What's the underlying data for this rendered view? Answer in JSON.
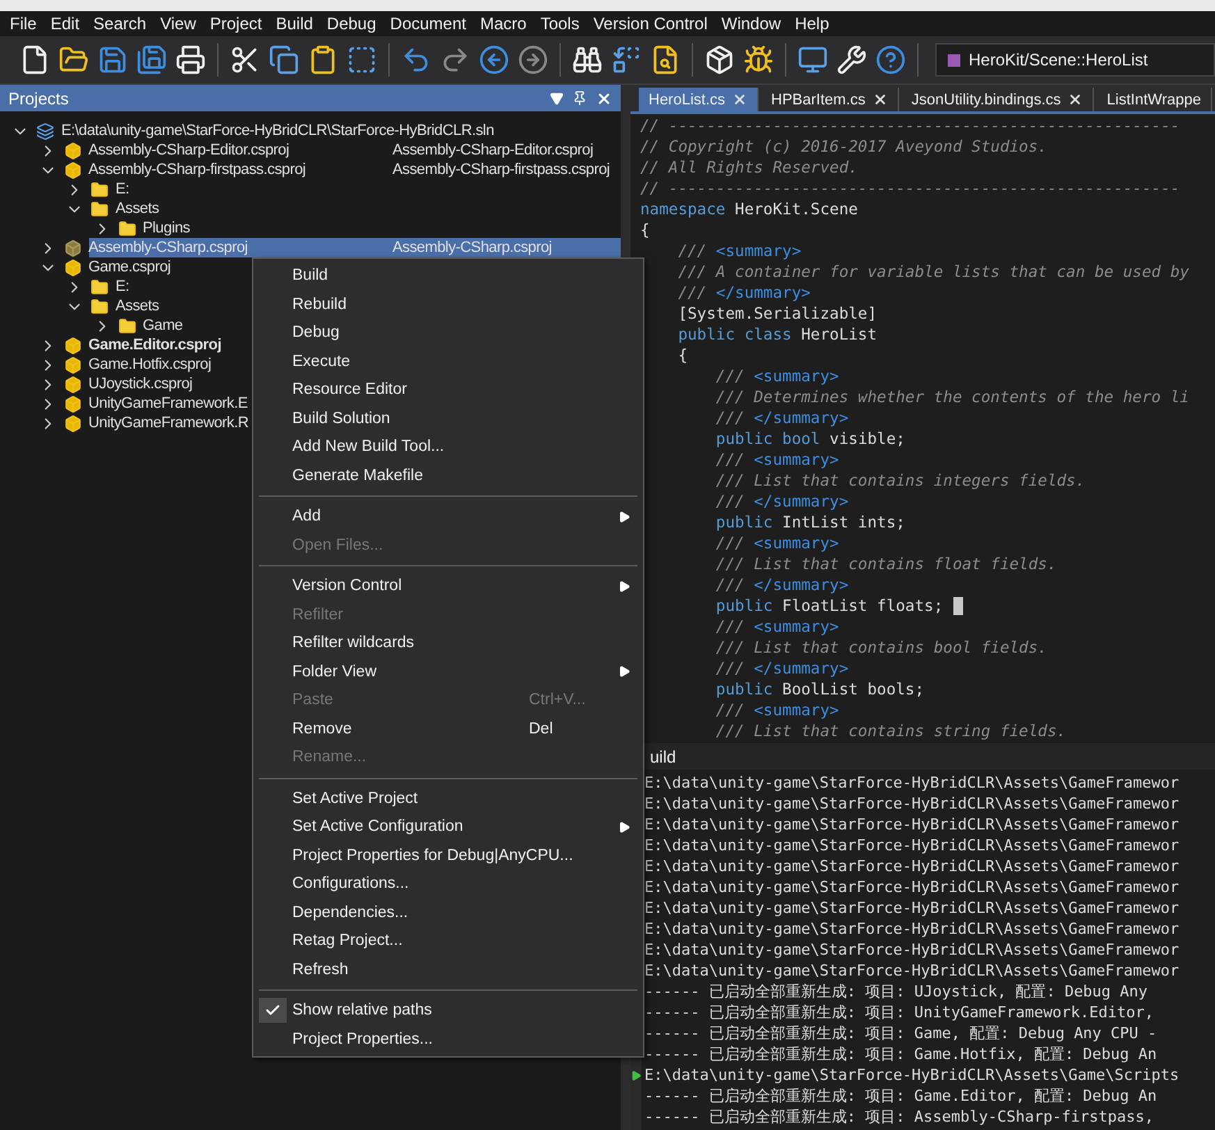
{
  "menu_bar": [
    "File",
    "Edit",
    "Search",
    "View",
    "Project",
    "Build",
    "Debug",
    "Document",
    "Macro",
    "Tools",
    "Version Control",
    "Window",
    "Help"
  ],
  "toolbar": {
    "symbol_dropdown": "HeroKit/Scene::HeroList"
  },
  "projects_panel": {
    "title": "Projects",
    "tree": [
      {
        "kind": "solution",
        "label": "E:\\data\\unity-game\\StarForce-HyBridCLR\\StarForce-HyBridCLR.sln",
        "expanded": true,
        "selected": false,
        "bold": false,
        "children": [
          {
            "kind": "project",
            "label": "Assembly-CSharp-Editor.csproj",
            "detail": "Assembly-CSharp-Editor.csproj",
            "expanded": false,
            "selected": false,
            "bold": false
          },
          {
            "kind": "project",
            "label": "Assembly-CSharp-firstpass.csproj",
            "detail": "Assembly-CSharp-firstpass.csproj",
            "expanded": true,
            "selected": false,
            "bold": false,
            "children": [
              {
                "kind": "folder",
                "label": "E:",
                "expanded": false,
                "selected": false,
                "bold": false
              },
              {
                "kind": "folder",
                "label": "Assets",
                "expanded": true,
                "selected": false,
                "bold": false,
                "children": [
                  {
                    "kind": "folder",
                    "label": "Plugins",
                    "expanded": false,
                    "selected": false,
                    "bold": false
                  }
                ]
              }
            ]
          },
          {
            "kind": "project",
            "label": "Assembly-CSharp.csproj",
            "detail": "Assembly-CSharp.csproj",
            "expanded": false,
            "selected": true,
            "bold": false
          },
          {
            "kind": "project",
            "label": "Game.csproj",
            "expanded": true,
            "selected": false,
            "bold": false,
            "children": [
              {
                "kind": "folder",
                "label": "E:",
                "expanded": false,
                "selected": false,
                "bold": false
              },
              {
                "kind": "folder",
                "label": "Assets",
                "expanded": true,
                "selected": false,
                "bold": false,
                "children": [
                  {
                    "kind": "folder",
                    "label": "Game",
                    "expanded": false,
                    "selected": false,
                    "bold": false
                  }
                ]
              }
            ]
          },
          {
            "kind": "project",
            "label": "Game.Editor.csproj",
            "expanded": false,
            "selected": false,
            "bold": true
          },
          {
            "kind": "project",
            "label": "Game.Hotfix.csproj",
            "expanded": false,
            "selected": false,
            "bold": false
          },
          {
            "kind": "project",
            "label": "UJoystick.csproj",
            "expanded": false,
            "selected": false,
            "bold": false
          },
          {
            "kind": "project",
            "label": "UnityGameFramework.E",
            "expanded": false,
            "selected": false,
            "bold": false
          },
          {
            "kind": "project",
            "label": "UnityGameFramework.R",
            "expanded": false,
            "selected": false,
            "bold": false
          }
        ]
      }
    ]
  },
  "editor": {
    "tabs": [
      {
        "label": "HeroList.cs",
        "selected": true
      },
      {
        "label": "HPBarItem.cs",
        "selected": false
      },
      {
        "label": "JsonUtility.bindings.cs",
        "selected": false
      },
      {
        "label": "ListIntWrappe",
        "selected": false
      }
    ],
    "lines": [
      {
        "cursor": false,
        "segments": [
          {
            "kind": "comment",
            "t": "// ------------------------------------------------------"
          }
        ]
      },
      {
        "cursor": false,
        "segments": [
          {
            "kind": "comment",
            "t": "// Copyright (c) 2016-2017 Aveyond Studios."
          }
        ]
      },
      {
        "cursor": false,
        "segments": [
          {
            "kind": "comment",
            "t": "// All Rights Reserved."
          }
        ]
      },
      {
        "cursor": false,
        "segments": [
          {
            "kind": "comment",
            "t": "// ------------------------------------------------------"
          }
        ]
      },
      {
        "cursor": false,
        "segments": [
          {
            "kind": "keyword",
            "t": "namespace"
          },
          {
            "kind": "plain",
            "t": " HeroKit.Scene"
          }
        ]
      },
      {
        "cursor": false,
        "segments": [
          {
            "kind": "plain",
            "t": "{"
          }
        ]
      },
      {
        "cursor": false,
        "segments": [
          {
            "kind": "comment",
            "t": "    /// "
          },
          {
            "kind": "tag",
            "t": "<summary>"
          }
        ]
      },
      {
        "cursor": false,
        "segments": [
          {
            "kind": "comment",
            "t": "    /// A container for variable lists that can be used by"
          }
        ]
      },
      {
        "cursor": false,
        "segments": [
          {
            "kind": "comment",
            "t": "    /// "
          },
          {
            "kind": "tag",
            "t": "</summary>"
          }
        ]
      },
      {
        "cursor": false,
        "segments": [
          {
            "kind": "plain",
            "t": "    [System.Serializable]"
          }
        ]
      },
      {
        "cursor": false,
        "segments": [
          {
            "kind": "keyword",
            "t": "    public class"
          },
          {
            "kind": "plain",
            "t": " HeroList"
          }
        ]
      },
      {
        "cursor": false,
        "segments": [
          {
            "kind": "plain",
            "t": "    {"
          }
        ]
      },
      {
        "cursor": false,
        "segments": [
          {
            "kind": "comment",
            "t": "        /// "
          },
          {
            "kind": "tag",
            "t": "<summary>"
          }
        ]
      },
      {
        "cursor": false,
        "segments": [
          {
            "kind": "comment",
            "t": "        /// Determines whether the contents of the hero li"
          }
        ]
      },
      {
        "cursor": false,
        "segments": [
          {
            "kind": "comment",
            "t": "        /// "
          },
          {
            "kind": "tag",
            "t": "</summary>"
          }
        ]
      },
      {
        "cursor": false,
        "segments": [
          {
            "kind": "keyword",
            "t": "        public bool"
          },
          {
            "kind": "plain",
            "t": " visible;"
          }
        ]
      },
      {
        "cursor": false,
        "segments": [
          {
            "kind": "comment",
            "t": "        /// "
          },
          {
            "kind": "tag",
            "t": "<summary>"
          }
        ]
      },
      {
        "cursor": false,
        "segments": [
          {
            "kind": "comment",
            "t": "        /// List that contains integers fields."
          }
        ]
      },
      {
        "cursor": false,
        "segments": [
          {
            "kind": "comment",
            "t": "        /// "
          },
          {
            "kind": "tag",
            "t": "</summary>"
          }
        ]
      },
      {
        "cursor": false,
        "segments": [
          {
            "kind": "keyword",
            "t": "        public"
          },
          {
            "kind": "plain",
            "t": " IntList ints;"
          }
        ]
      },
      {
        "cursor": false,
        "segments": [
          {
            "kind": "comment",
            "t": "        /// "
          },
          {
            "kind": "tag",
            "t": "<summary>"
          }
        ]
      },
      {
        "cursor": false,
        "segments": [
          {
            "kind": "comment",
            "t": "        /// List that contains float fields."
          }
        ]
      },
      {
        "cursor": false,
        "segments": [
          {
            "kind": "comment",
            "t": "        /// "
          },
          {
            "kind": "tag",
            "t": "</summary>"
          }
        ]
      },
      {
        "cursor": true,
        "segments": [
          {
            "kind": "keyword",
            "t": "        public"
          },
          {
            "kind": "plain",
            "t": " FloatList floats;"
          }
        ]
      },
      {
        "cursor": false,
        "segments": [
          {
            "kind": "comment",
            "t": "        /// "
          },
          {
            "kind": "tag",
            "t": "<summary>"
          }
        ]
      },
      {
        "cursor": false,
        "segments": [
          {
            "kind": "comment",
            "t": "        /// List that contains bool fields."
          }
        ]
      },
      {
        "cursor": false,
        "segments": [
          {
            "kind": "comment",
            "t": "        /// "
          },
          {
            "kind": "tag",
            "t": "</summary>"
          }
        ]
      },
      {
        "cursor": false,
        "segments": [
          {
            "kind": "keyword",
            "t": "        public"
          },
          {
            "kind": "plain",
            "t": " BoolList bools;"
          }
        ]
      },
      {
        "cursor": false,
        "segments": [
          {
            "kind": "comment",
            "t": "        /// "
          },
          {
            "kind": "tag",
            "t": "<summary>"
          }
        ]
      },
      {
        "cursor": false,
        "segments": [
          {
            "kind": "comment",
            "t": "        /// List that contains string fields."
          }
        ]
      }
    ]
  },
  "build_panel": {
    "title": "uild",
    "lines": [
      {
        "marker": false,
        "text": "E:\\data\\unity-game\\StarForce-HyBridCLR\\Assets\\GameFramewor"
      },
      {
        "marker": false,
        "text": "E:\\data\\unity-game\\StarForce-HyBridCLR\\Assets\\GameFramewor"
      },
      {
        "marker": false,
        "text": "E:\\data\\unity-game\\StarForce-HyBridCLR\\Assets\\GameFramewor"
      },
      {
        "marker": false,
        "text": "E:\\data\\unity-game\\StarForce-HyBridCLR\\Assets\\GameFramewor"
      },
      {
        "marker": false,
        "text": "E:\\data\\unity-game\\StarForce-HyBridCLR\\Assets\\GameFramewor"
      },
      {
        "marker": false,
        "text": "E:\\data\\unity-game\\StarForce-HyBridCLR\\Assets\\GameFramewor"
      },
      {
        "marker": false,
        "text": "E:\\data\\unity-game\\StarForce-HyBridCLR\\Assets\\GameFramewor"
      },
      {
        "marker": false,
        "text": "E:\\data\\unity-game\\StarForce-HyBridCLR\\Assets\\GameFramewor"
      },
      {
        "marker": false,
        "text": "E:\\data\\unity-game\\StarForce-HyBridCLR\\Assets\\GameFramewor"
      },
      {
        "marker": false,
        "text": "E:\\data\\unity-game\\StarForce-HyBridCLR\\Assets\\GameFramewor"
      },
      {
        "marker": false,
        "text": "------ 已启动全部重新生成: 项目: UJoystick, 配置: Debug Any"
      },
      {
        "marker": false,
        "text": "------ 已启动全部重新生成: 项目: UnityGameFramework.Editor,"
      },
      {
        "marker": false,
        "text": "------ 已启动全部重新生成: 项目: Game, 配置: Debug Any CPU -"
      },
      {
        "marker": false,
        "text": "------ 已启动全部重新生成: 项目: Game.Hotfix, 配置: Debug An"
      },
      {
        "marker": true,
        "text": "E:\\data\\unity-game\\StarForce-HyBridCLR\\Assets\\Game\\Scripts"
      },
      {
        "marker": false,
        "text": "------ 已启动全部重新生成: 项目: Game.Editor, 配置: Debug An"
      },
      {
        "marker": false,
        "text": "------ 已启动全部重新生成: 项目: Assembly-CSharp-firstpass,"
      }
    ]
  },
  "context_menu": [
    {
      "kind": "item",
      "label": "Build",
      "disabled": false,
      "submenu": false,
      "checked": false
    },
    {
      "kind": "item",
      "label": "Rebuild",
      "disabled": false,
      "submenu": false,
      "checked": false
    },
    {
      "kind": "item",
      "label": "Debug",
      "disabled": false,
      "submenu": false,
      "checked": false
    },
    {
      "kind": "item",
      "label": "Execute",
      "disabled": false,
      "submenu": false,
      "checked": false
    },
    {
      "kind": "item",
      "label": "Resource Editor",
      "disabled": false,
      "submenu": false,
      "checked": false
    },
    {
      "kind": "item",
      "label": "Build Solution",
      "disabled": false,
      "submenu": false,
      "checked": false
    },
    {
      "kind": "item",
      "label": "Add New Build Tool...",
      "disabled": false,
      "submenu": false,
      "checked": false
    },
    {
      "kind": "item",
      "label": "Generate Makefile",
      "disabled": false,
      "submenu": false,
      "checked": false
    },
    {
      "kind": "separator"
    },
    {
      "kind": "item",
      "label": "Add",
      "disabled": false,
      "submenu": true,
      "checked": false
    },
    {
      "kind": "item",
      "label": "Open Files...",
      "disabled": true,
      "submenu": false,
      "checked": false
    },
    {
      "kind": "separator"
    },
    {
      "kind": "item",
      "label": "Version Control",
      "disabled": false,
      "submenu": true,
      "checked": false
    },
    {
      "kind": "item",
      "label": "Refilter",
      "disabled": true,
      "submenu": false,
      "checked": false
    },
    {
      "kind": "item",
      "label": "Refilter wildcards",
      "disabled": false,
      "submenu": false,
      "checked": false
    },
    {
      "kind": "item",
      "label": "Folder View",
      "disabled": false,
      "submenu": true,
      "checked": false
    },
    {
      "kind": "item",
      "label": "Paste",
      "shortcut": "Ctrl+V...",
      "disabled": true,
      "submenu": false,
      "checked": false
    },
    {
      "kind": "item",
      "label": "Remove",
      "shortcut": "Del",
      "disabled": false,
      "submenu": false,
      "checked": false
    },
    {
      "kind": "item",
      "label": "Rename...",
      "disabled": true,
      "submenu": false,
      "checked": false
    },
    {
      "kind": "separator"
    },
    {
      "kind": "item",
      "label": "Set Active Project",
      "disabled": false,
      "submenu": false,
      "checked": false
    },
    {
      "kind": "item",
      "label": "Set Active Configuration",
      "disabled": false,
      "submenu": true,
      "checked": false
    },
    {
      "kind": "item",
      "label": "Project Properties for Debug|AnyCPU...",
      "disabled": false,
      "submenu": false,
      "checked": false
    },
    {
      "kind": "item",
      "label": "Configurations...",
      "disabled": false,
      "submenu": false,
      "checked": false
    },
    {
      "kind": "item",
      "label": "Dependencies...",
      "disabled": false,
      "submenu": false,
      "checked": false
    },
    {
      "kind": "item",
      "label": "Retag Project...",
      "disabled": false,
      "submenu": false,
      "checked": false
    },
    {
      "kind": "item",
      "label": "Refresh",
      "disabled": false,
      "submenu": false,
      "checked": false
    },
    {
      "kind": "separator"
    },
    {
      "kind": "item",
      "label": "Show relative paths",
      "disabled": false,
      "submenu": false,
      "checked": true
    },
    {
      "kind": "item",
      "label": "Project Properties...",
      "disabled": false,
      "submenu": false,
      "checked": false
    }
  ]
}
